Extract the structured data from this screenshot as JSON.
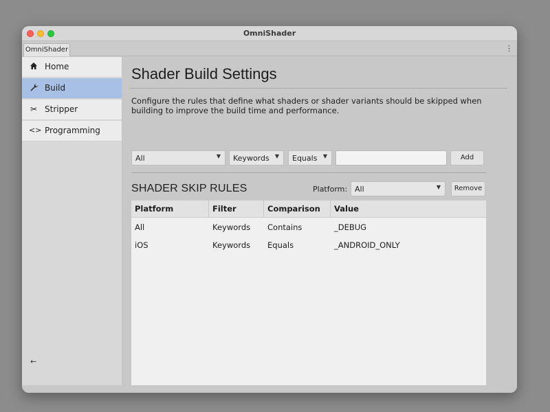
{
  "window": {
    "title": "OmniShader"
  },
  "tabbar": {
    "tab_label": "OmniShader",
    "menu_icon": "kebab-menu-icon"
  },
  "sidebar": {
    "items": [
      {
        "label": "Home",
        "icon": "home-icon",
        "active": false
      },
      {
        "label": "Build",
        "icon": "wrench-icon",
        "active": true
      },
      {
        "label": "Stripper",
        "icon": "scissors-icon",
        "active": false
      },
      {
        "label": "Programming",
        "icon": "code-icon",
        "active": false
      }
    ],
    "collapse_icon": "arrow-left-icon"
  },
  "main": {
    "title": "Shader Build Settings",
    "description": "Configure the rules that define what shaders or shader variants should be skipped when building to improve the build time and performance.",
    "add_rule": {
      "platform_value": "All",
      "filter_value": "Keywords",
      "comparison_value": "Equals",
      "value_input": "",
      "add_label": "Add"
    },
    "rules": {
      "title": "SHADER SKIP RULES",
      "platform_label": "Platform:",
      "platform_value": "All",
      "remove_label": "Remove",
      "columns": [
        "Platform",
        "Filter",
        "Comparison",
        "Value"
      ],
      "rows": [
        [
          "All",
          "Keywords",
          "Contains",
          "_DEBUG"
        ],
        [
          "iOS",
          "Keywords",
          "Equals",
          "_ANDROID_ONLY"
        ]
      ]
    }
  },
  "colors": {
    "active_nav": "#a8bfe6",
    "background": "#c8c8c8",
    "table_background": "#f0f0f0"
  }
}
